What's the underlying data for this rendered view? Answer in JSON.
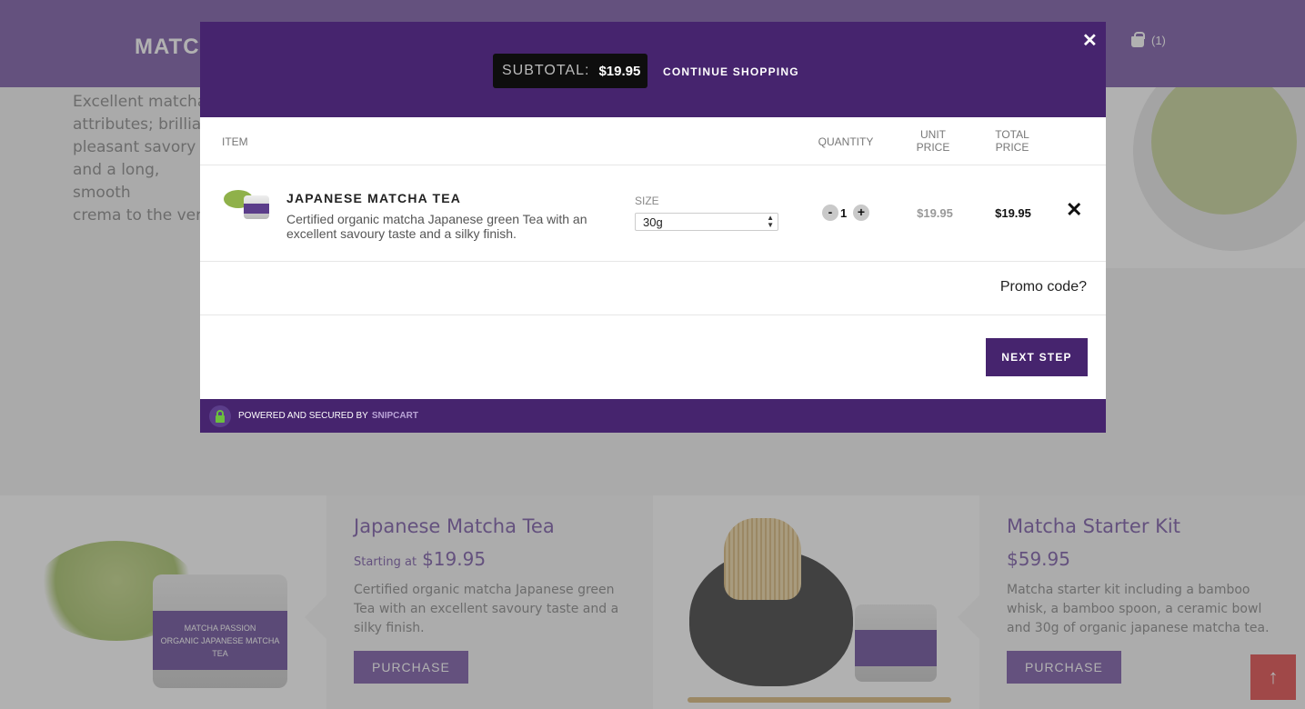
{
  "background": {
    "logo": "MATCH",
    "cart_count": "(1)",
    "intro_text": "Excellent matcha r\nattributes; brilliant\npleasant savory ta\nand a long, smooth\ncrema to the very",
    "products": [
      {
        "title": "Japanese Matcha Tea",
        "price_prefix": "Starting at",
        "price": "$19.95",
        "description": "Certified organic matcha Japanese green Tea with an excellent savoury taste and a silky finish.",
        "button": "PURCHASE",
        "tin_label": "MATCHA PASSION\nORGANIC JAPANESE MATCHA TEA"
      },
      {
        "title": "Matcha Starter Kit",
        "price_prefix": "",
        "price": "$59.95",
        "description": "Matcha starter kit including a bamboo whisk, a bamboo spoon, a ceramic bowl and 30g of organic japanese matcha tea.",
        "button": "PURCHASE"
      }
    ],
    "back_to_top_icon": "arrow-up-icon"
  },
  "cart": {
    "subtotal_label": "SUBTOTAL:",
    "subtotal_value": "$19.95",
    "continue_label": "CONTINUE SHOPPING",
    "close_glyph": "✕",
    "columns": {
      "item": "ITEM",
      "quantity": "QUANTITY",
      "unit_price": "UNIT\nPRICE",
      "total_price": "TOTAL\nPRICE"
    },
    "items": [
      {
        "name": "JAPANESE MATCHA TEA",
        "description": "Certified organic matcha Japanese green Tea with an excellent savoury taste and a silky finish.",
        "size_label": "SIZE",
        "size_value": "30g",
        "quantity": "1",
        "unit_price": "$19.95",
        "total_price": "$19.95",
        "remove_glyph": "✕"
      }
    ],
    "qty_minus": "-",
    "qty_plus": "+",
    "promo_label": "Promo code?",
    "next_label": "NEXT STEP",
    "footer_text": "POWERED AND SECURED BY",
    "footer_brand": "SNIPCART"
  },
  "colors": {
    "brand_purple": "#46246e",
    "header_purple": "#7a5aa8",
    "lock_green": "#6cbf3e"
  }
}
